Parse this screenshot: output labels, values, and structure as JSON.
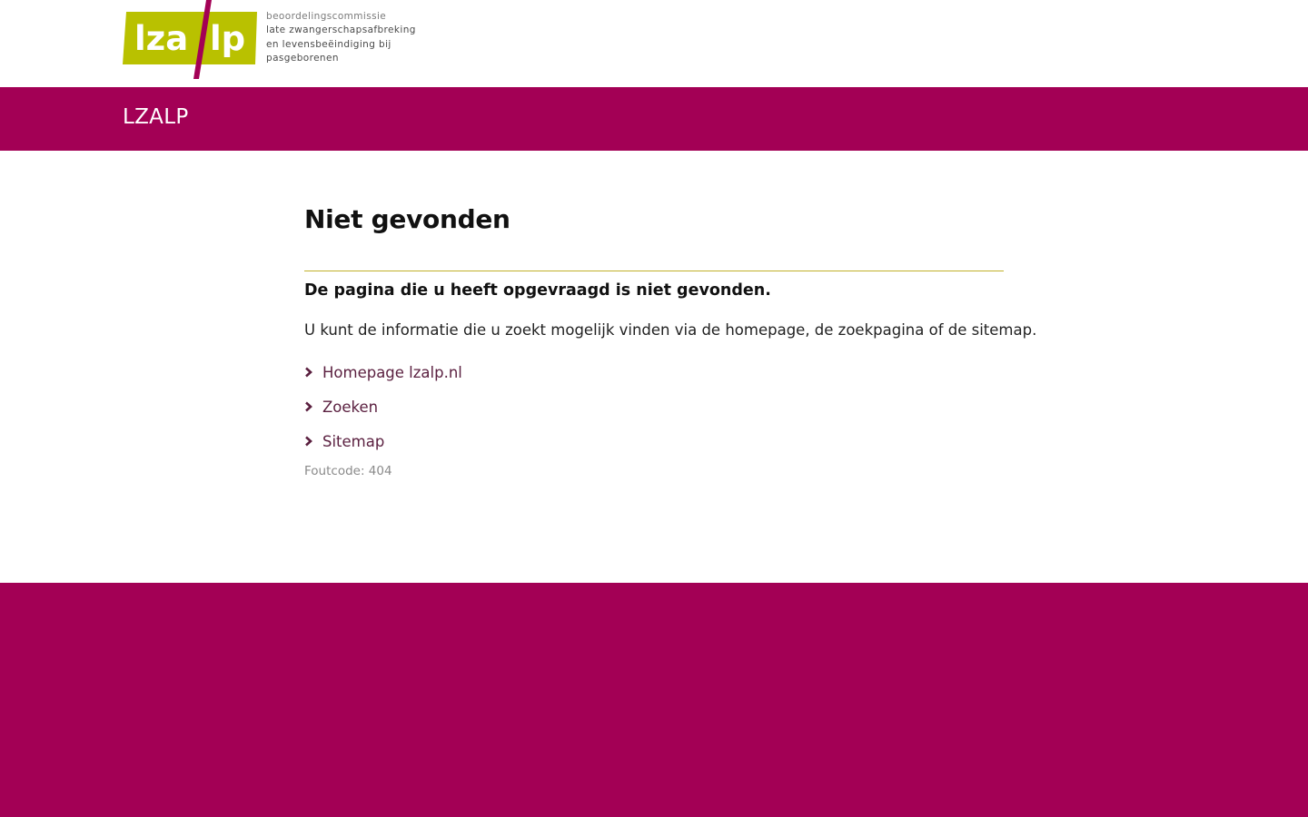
{
  "header": {
    "logo": {
      "mark_text_left": "lza",
      "mark_text_right": "lp",
      "tagline": [
        "beoordelingscommissie",
        "late zwangerschapsafbreking",
        "en levensbeëindiging bij",
        "pasgeborenen"
      ]
    }
  },
  "title_bar": {
    "site_name": "LZALP"
  },
  "main": {
    "title": "Niet gevonden",
    "lead": "De pagina die u heeft opgevraagd is niet gevonden.",
    "intro": "U kunt de informatie die u zoekt mogelijk vinden via de homepage, de zoekpagina of de sitemap.",
    "links": [
      {
        "label": "Homepage lzalp.nl",
        "icon": "chevron-right-icon"
      },
      {
        "label": "Zoeken",
        "icon": "chevron-right-icon"
      },
      {
        "label": "Sitemap",
        "icon": "chevron-right-icon"
      }
    ],
    "error_code": "Foutcode: 404"
  },
  "colors": {
    "brand_magenta": "#a30055",
    "brand_lime": "#b9c100",
    "rule_gold": "#c1b12b",
    "link": "#5a1f3f"
  }
}
